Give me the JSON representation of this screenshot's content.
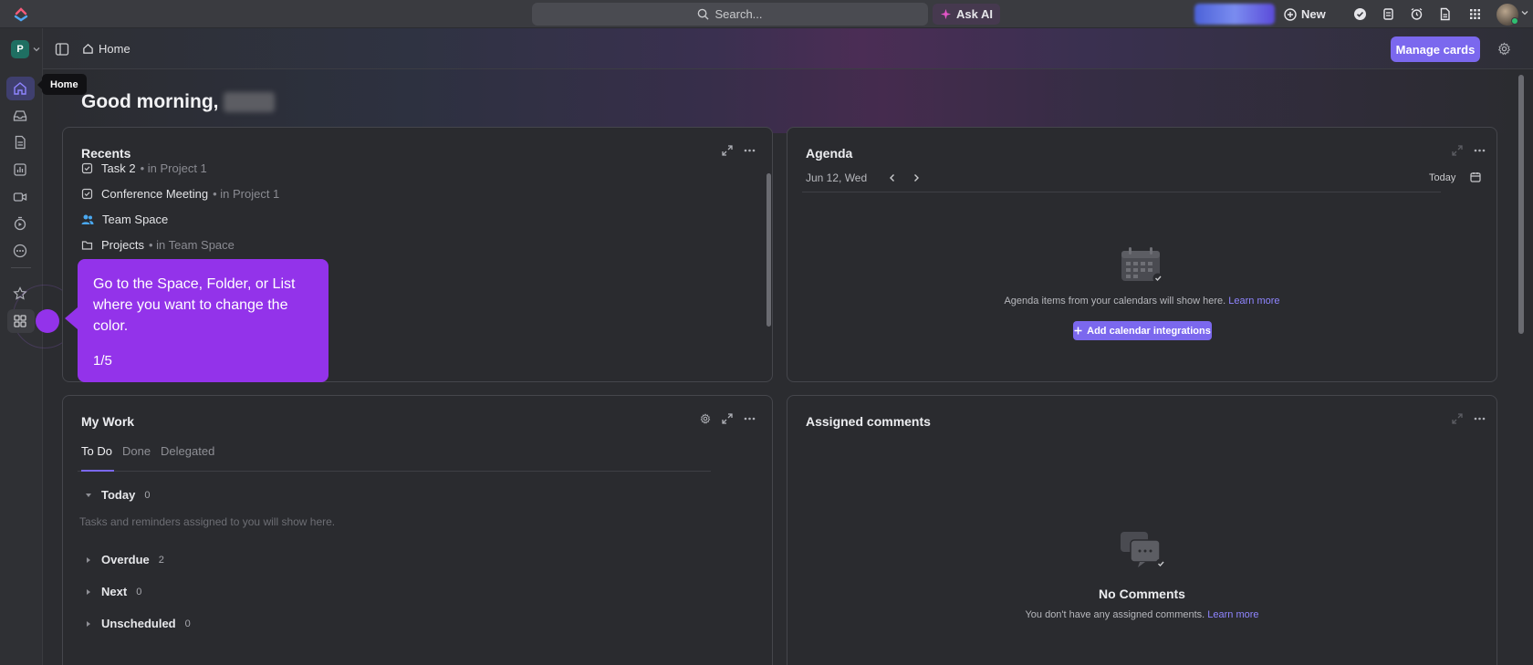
{
  "topbar": {
    "search_placeholder": "Search...",
    "ask_ai_label": "Ask AI",
    "new_label": "New"
  },
  "header": {
    "breadcrumb_label": "Home",
    "manage_cards_label": "Manage cards"
  },
  "greeting": "Good morning,",
  "tooltip": "Home",
  "workspace_initial": "P",
  "recents": {
    "title": "Recents",
    "items": [
      {
        "name": "Task 2",
        "location": "• in Project 1"
      },
      {
        "name": "Conference Meeting",
        "location": "• in Project 1"
      },
      {
        "name": "Team Space",
        "location": ""
      },
      {
        "name": "Projects",
        "location": "• in Team Space"
      }
    ]
  },
  "agenda": {
    "title": "Agenda",
    "date": "Jun 12, Wed",
    "today_label": "Today",
    "empty_text": "Agenda items from your calendars will show here.",
    "learn_more": "Learn more",
    "add_button": "Add calendar integrations"
  },
  "my_work": {
    "title": "My Work",
    "tabs": [
      "To Do",
      "Done",
      "Delegated"
    ],
    "groups": [
      {
        "label": "Today",
        "count": "0"
      },
      {
        "label": "Overdue",
        "count": "2"
      },
      {
        "label": "Next",
        "count": "0"
      },
      {
        "label": "Unscheduled",
        "count": "0"
      }
    ],
    "empty_text": "Tasks and reminders assigned to you will show here."
  },
  "assigned_comments": {
    "title": "Assigned comments",
    "empty_title": "No Comments",
    "empty_text": "You don't have any assigned comments.",
    "learn_more": "Learn more"
  },
  "walkthrough": {
    "text": "Go to the Space, Folder, or List where you want to change the color.",
    "step": "1/5"
  },
  "colors": {
    "accent": "#7b68ee",
    "walkthrough": "#9333ea",
    "background": "#2b2c30"
  }
}
